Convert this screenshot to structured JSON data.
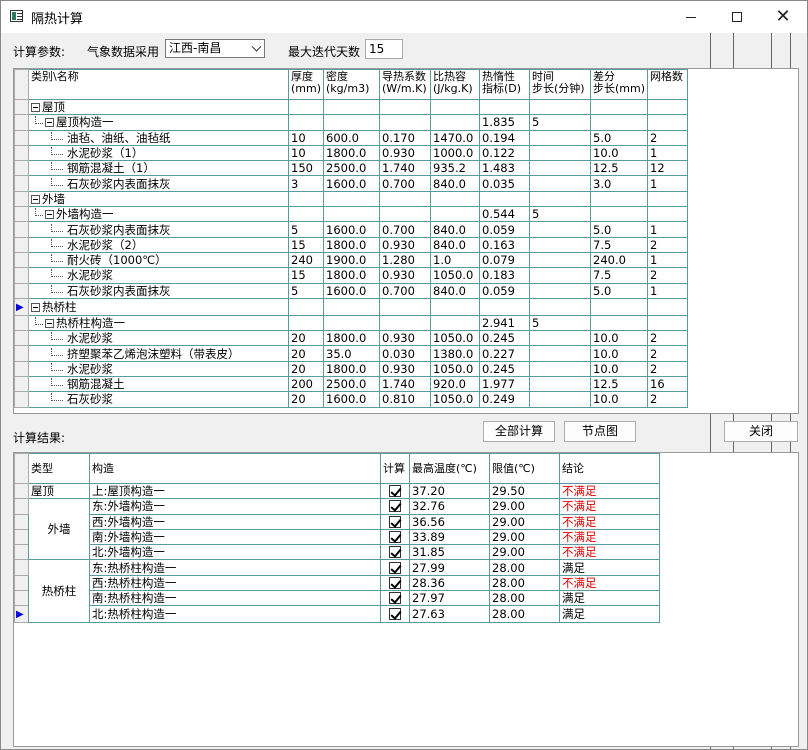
{
  "window": {
    "title": "隔热计算",
    "minimize_glyph": "—",
    "close_glyph": "✕"
  },
  "params": {
    "label": "计算参数:",
    "weather_label": "气象数据采用",
    "weather_value": "江西-南昌",
    "max_days_label": "最大迭代天数",
    "max_days_value": "15"
  },
  "upper_grid": {
    "headers": [
      "类别\\名称",
      "厚度\n(mm)",
      "密度\n(kg/m3)",
      "导热系数\n(W/m.K)",
      "比热容\n(J/kg.K)",
      "热惰性\n指标(D)",
      "时间\n步长(分钟)",
      "差分\n步长(mm)",
      "网格数"
    ],
    "rows": [
      {
        "level": 0,
        "name": "屋顶",
        "marker": false,
        "cells": [
          "",
          "",
          "",
          "",
          "",
          "",
          "",
          ""
        ]
      },
      {
        "level": 1,
        "name": "屋顶构造一",
        "marker": false,
        "cells": [
          "",
          "",
          "",
          "",
          "1.835",
          "5",
          "",
          ""
        ]
      },
      {
        "level": 2,
        "name": "油毡、油纸、油毡纸",
        "marker": false,
        "cells": [
          "10",
          "600.0",
          "0.170",
          "1470.0",
          "0.194",
          "",
          "5.0",
          "2"
        ]
      },
      {
        "level": 2,
        "name": "水泥砂浆（1）",
        "marker": false,
        "cells": [
          "10",
          "1800.0",
          "0.930",
          "1000.0",
          "0.122",
          "",
          "10.0",
          "1"
        ]
      },
      {
        "level": 2,
        "name": "钢筋混凝土（1）",
        "marker": false,
        "cells": [
          "150",
          "2500.0",
          "1.740",
          "935.2",
          "1.483",
          "",
          "12.5",
          "12"
        ]
      },
      {
        "level": 2,
        "name": "石灰砂浆内表面抹灰",
        "marker": false,
        "cells": [
          "3",
          "1600.0",
          "0.700",
          "840.0",
          "0.035",
          "",
          "3.0",
          "1"
        ]
      },
      {
        "level": 0,
        "name": "外墙",
        "marker": false,
        "cells": [
          "",
          "",
          "",
          "",
          "",
          "",
          "",
          ""
        ]
      },
      {
        "level": 1,
        "name": "外墙构造一",
        "marker": false,
        "cells": [
          "",
          "",
          "",
          "",
          "0.544",
          "5",
          "",
          ""
        ]
      },
      {
        "level": 2,
        "name": "石灰砂浆内表面抹灰",
        "marker": false,
        "cells": [
          "5",
          "1600.0",
          "0.700",
          "840.0",
          "0.059",
          "",
          "5.0",
          "1"
        ]
      },
      {
        "level": 2,
        "name": "水泥砂浆（2）",
        "marker": false,
        "cells": [
          "15",
          "1800.0",
          "0.930",
          "840.0",
          "0.163",
          "",
          "7.5",
          "2"
        ]
      },
      {
        "level": 2,
        "name": "耐火砖（1000℃）",
        "marker": false,
        "cells": [
          "240",
          "1900.0",
          "1.280",
          "1.0",
          "0.079",
          "",
          "240.0",
          "1"
        ]
      },
      {
        "level": 2,
        "name": "水泥砂浆",
        "marker": false,
        "cells": [
          "15",
          "1800.0",
          "0.930",
          "1050.0",
          "0.183",
          "",
          "7.5",
          "2"
        ]
      },
      {
        "level": 2,
        "name": "石灰砂浆内表面抹灰",
        "marker": false,
        "cells": [
          "5",
          "1600.0",
          "0.700",
          "840.0",
          "0.059",
          "",
          "5.0",
          "1"
        ]
      },
      {
        "level": 0,
        "name": "热桥柱",
        "marker": true,
        "cells": [
          "",
          "",
          "",
          "",
          "",
          "",
          "",
          ""
        ]
      },
      {
        "level": 1,
        "name": "热桥柱构造一",
        "marker": false,
        "cells": [
          "",
          "",
          "",
          "",
          "2.941",
          "5",
          "",
          ""
        ]
      },
      {
        "level": 2,
        "name": "水泥砂浆",
        "marker": false,
        "cells": [
          "20",
          "1800.0",
          "0.930",
          "1050.0",
          "0.245",
          "",
          "10.0",
          "2"
        ]
      },
      {
        "level": 2,
        "name": "挤塑聚苯乙烯泡沫塑料（带表皮）",
        "marker": false,
        "cells": [
          "20",
          "35.0",
          "0.030",
          "1380.0",
          "0.227",
          "",
          "10.0",
          "2"
        ]
      },
      {
        "level": 2,
        "name": "水泥砂浆",
        "marker": false,
        "cells": [
          "20",
          "1800.0",
          "0.930",
          "1050.0",
          "0.245",
          "",
          "10.0",
          "2"
        ]
      },
      {
        "level": 2,
        "name": "钢筋混凝土",
        "marker": false,
        "cells": [
          "200",
          "2500.0",
          "1.740",
          "920.0",
          "1.977",
          "",
          "12.5",
          "16"
        ]
      },
      {
        "level": 2,
        "name": "石灰砂浆",
        "marker": false,
        "cells": [
          "20",
          "1600.0",
          "0.810",
          "1050.0",
          "0.249",
          "",
          "10.0",
          "2"
        ]
      }
    ]
  },
  "results": {
    "label": "计算结果:",
    "calc_all_button": "全部计算",
    "node_chart_button": "节点图",
    "close_button": "关闭",
    "headers": [
      "类型",
      "构造",
      "计算",
      "最高温度(℃)",
      "限值(℃)",
      "结论"
    ],
    "groups": [
      {
        "type": "屋顶",
        "rows": [
          {
            "construct": "上:屋顶构造一",
            "checked": true,
            "max_temp": "37.20",
            "limit": "29.50",
            "result": "不满足",
            "ok": false,
            "marker": false
          }
        ]
      },
      {
        "type": "外墙",
        "rows": [
          {
            "construct": "东:外墙构造一",
            "checked": true,
            "max_temp": "32.76",
            "limit": "29.00",
            "result": "不满足",
            "ok": false,
            "marker": false
          },
          {
            "construct": "西:外墙构造一",
            "checked": true,
            "max_temp": "36.56",
            "limit": "29.00",
            "result": "不满足",
            "ok": false,
            "marker": false
          },
          {
            "construct": "南:外墙构造一",
            "checked": true,
            "max_temp": "33.89",
            "limit": "29.00",
            "result": "不满足",
            "ok": false,
            "marker": false
          },
          {
            "construct": "北:外墙构造一",
            "checked": true,
            "max_temp": "31.85",
            "limit": "29.00",
            "result": "不满足",
            "ok": false,
            "marker": false
          }
        ]
      },
      {
        "type": "热桥柱",
        "rows": [
          {
            "construct": "东:热桥柱构造一",
            "checked": true,
            "max_temp": "27.99",
            "limit": "28.00",
            "result": "满足",
            "ok": true,
            "marker": false
          },
          {
            "construct": "西:热桥柱构造一",
            "checked": true,
            "max_temp": "28.36",
            "limit": "28.00",
            "result": "不满足",
            "ok": false,
            "marker": false
          },
          {
            "construct": "南:热桥柱构造一",
            "checked": true,
            "max_temp": "27.97",
            "limit": "28.00",
            "result": "满足",
            "ok": true,
            "marker": false
          },
          {
            "construct": "北:热桥柱构造一",
            "checked": true,
            "max_temp": "27.63",
            "limit": "28.00",
            "result": "满足",
            "ok": true,
            "marker": true
          }
        ]
      }
    ]
  },
  "colors": {
    "fail": "#e00000",
    "grid_line": "#5a9aa0",
    "marker": "#0000dd"
  }
}
